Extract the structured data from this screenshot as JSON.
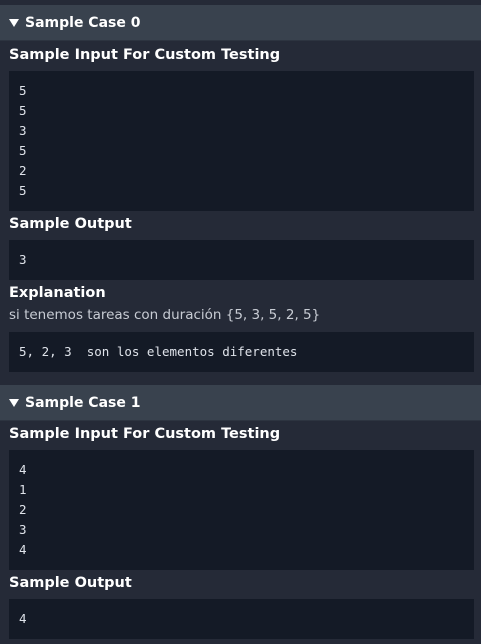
{
  "cases": [
    {
      "title": "Sample Case 0",
      "input_label": "Sample Input For Custom Testing",
      "input_lines": [
        "5",
        "5",
        "3",
        "5",
        "2",
        "5"
      ],
      "output_label": "Sample Output",
      "output_lines": [
        "3"
      ],
      "explanation_label": "Explanation",
      "explanation_text": "si tenemos tareas con duración {5, 3, 5, 2, 5}",
      "explanation_code": "5, 2, 3  son los elementos diferentes"
    },
    {
      "title": "Sample Case 1",
      "input_label": "Sample Input For Custom Testing",
      "input_lines": [
        "4",
        "1",
        "2",
        "3",
        "4"
      ],
      "output_label": "Sample Output",
      "output_lines": [
        "4"
      ]
    }
  ],
  "colors": {
    "background": "#252a37",
    "header": "#39424e",
    "code_bg": "#141a26"
  },
  "icons": {
    "expand": "caret-down-icon"
  }
}
